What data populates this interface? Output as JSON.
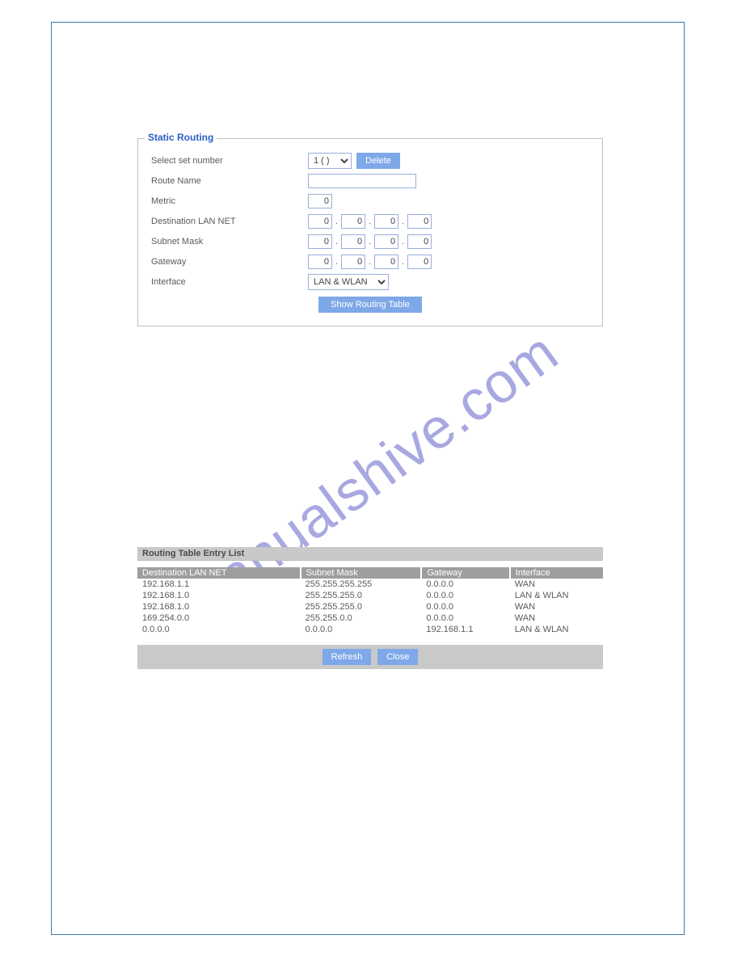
{
  "watermark": "manualshive.com",
  "panel": {
    "legend": "Static Routing",
    "labels": {
      "select_set": "Select set number",
      "route_name": "Route Name",
      "metric": "Metric",
      "dest_lan": "Destination LAN NET",
      "subnet": "Subnet Mask",
      "gateway": "Gateway",
      "interface": "Interface"
    },
    "set_option": "1 ( )",
    "delete_btn": "Delete",
    "route_name_value": "",
    "metric_value": "0",
    "dest_octets": [
      "0",
      "0",
      "0",
      "0"
    ],
    "subnet_octets": [
      "0",
      "0",
      "0",
      "0"
    ],
    "gateway_octets": [
      "0",
      "0",
      "0",
      "0"
    ],
    "iface_option": "LAN & WLAN",
    "show_btn": "Show Routing Table"
  },
  "rt": {
    "title": "Routing Table Entry List",
    "headers": [
      "Destination LAN NET",
      "Subnet Mask",
      "Gateway",
      "Interface"
    ],
    "rows": [
      [
        "192.168.1.1",
        "255.255.255.255",
        "0.0.0.0",
        "WAN"
      ],
      [
        "192.168.1.0",
        "255.255.255.0",
        "0.0.0.0",
        "LAN & WLAN"
      ],
      [
        "192.168.1.0",
        "255.255.255.0",
        "0.0.0.0",
        "WAN"
      ],
      [
        "169.254.0.0",
        "255.255.0.0",
        "0.0.0.0",
        "WAN"
      ],
      [
        "0.0.0.0",
        "0.0.0.0",
        "192.168.1.1",
        "LAN & WLAN"
      ]
    ],
    "refresh_btn": "Refresh",
    "close_btn": "Close"
  }
}
